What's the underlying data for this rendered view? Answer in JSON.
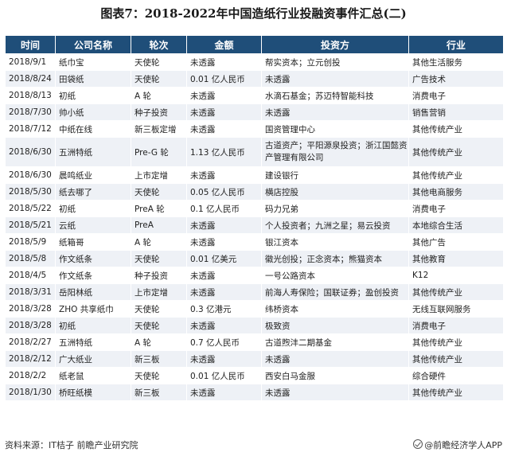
{
  "title": "图表7：2018-2022年中国造纸行业投融资事件汇总(二)",
  "headers": [
    "时间",
    "公司名称",
    "轮次",
    "金额",
    "投资方",
    "行业"
  ],
  "rows": [
    [
      "2018/9/1",
      "纸巾宝",
      "天使轮",
      "未透露",
      "帮实资本；立元创投",
      "其他生活服务"
    ],
    [
      "2018/8/24",
      "田袋纸",
      "天使轮",
      "0.01 亿人民币",
      "未透露",
      "广告技术"
    ],
    [
      "2018/8/13",
      "初纸",
      "A 轮",
      "未透露",
      "水滴石基金；苏迈特智能科技",
      "消费电子"
    ],
    [
      "2018/7/30",
      "帅小纸",
      "种子投资",
      "未透露",
      "未透露",
      "销售营销"
    ],
    [
      "2018/7/12",
      "中纸在线",
      "新三板定增",
      "未透露",
      "国资管理中心",
      "其他传统产业"
    ],
    [
      "2018/6/30",
      "五洲特纸",
      "Pre-G 轮",
      "1.13 亿人民币",
      "古道资产；平阳源泉投资；浙江国懿资产管理有限公司",
      "其他传统产业"
    ],
    [
      "2018/6/30",
      "晨鸣纸业",
      "上市定增",
      "未透露",
      "建设银行",
      "其他传统产业"
    ],
    [
      "2018/5/30",
      "纸去哪了",
      "天使轮",
      "0.05 亿人民币",
      "横店控股",
      "其他电商服务"
    ],
    [
      "2018/5/22",
      "初纸",
      "PreA 轮",
      "0.1 亿人民币",
      "码力兄弟",
      "消费电子"
    ],
    [
      "2018/5/21",
      "云纸",
      "PreA",
      "未透露",
      "个人投资者；九洲之星；易云投资",
      "本地综合生活"
    ],
    [
      "2018/5/9",
      "纸箱哥",
      "A 轮",
      "未透露",
      "银江资本",
      "其他广告"
    ],
    [
      "2018/5/8",
      "作文纸条",
      "天使轮",
      "0.01 亿美元",
      "徽光创投；正念资本；熊猫资本",
      "其他教育"
    ],
    [
      "2018/4/5",
      "作文纸条",
      "种子投资",
      "未透露",
      "一号公路资本",
      "K12"
    ],
    [
      "2018/3/31",
      "岳阳林纸",
      "上市定增",
      "未透露",
      "前海人寿保险；国联证券；盈创投资",
      "其他传统产业"
    ],
    [
      "2018/3/28",
      "ZHO 共享纸巾",
      "天使轮",
      "0.3 亿港元",
      "纬桥资本",
      "无线互联网服务"
    ],
    [
      "2018/3/28",
      "初纸",
      "天使轮",
      "未透露",
      "极致资",
      "消费电子"
    ],
    [
      "2018/2/27",
      "五洲特纸",
      "A 轮",
      "0.7 亿人民币",
      "古道煦沣二期基金",
      "其他传统产业"
    ],
    [
      "2018/2/12",
      "广大纸业",
      "新三板",
      "未透露",
      "未透露",
      "其他传统产业"
    ],
    [
      "2018/2/2",
      "纸老鼠",
      "天使轮",
      "0.01 亿人民币",
      "西安白马金服",
      "综合硬件"
    ],
    [
      "2018/1/30",
      "桥旺纸模",
      "新三板",
      "未透露",
      "未透露",
      "其他传统产业"
    ]
  ],
  "tall_row_index": 5,
  "footer": {
    "source": "资料来源：IT桔子 前瞻产业研究院",
    "brand": "@前瞻经济学人APP"
  },
  "watermark_text": "前瞻产业研究院",
  "colors": {
    "header_bg": "#1f4e79",
    "stripe_bg": "#eef1f6"
  }
}
